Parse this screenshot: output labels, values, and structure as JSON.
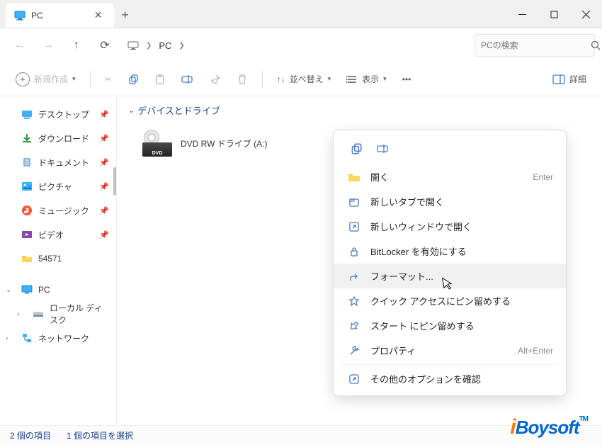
{
  "tab": {
    "title": "PC"
  },
  "address": {
    "location": "PC"
  },
  "search": {
    "placeholder": "PCの検索"
  },
  "toolbar": {
    "new": "新規作成",
    "sort": "並べ替え",
    "view": "表示",
    "details": "詳細"
  },
  "sidebar": {
    "items": [
      {
        "label": "デスクトップ"
      },
      {
        "label": "ダウンロード"
      },
      {
        "label": "ドキュメント"
      },
      {
        "label": "ピクチャ"
      },
      {
        "label": "ミュージック"
      },
      {
        "label": "ビデオ"
      },
      {
        "label": "54571"
      }
    ],
    "pc": "PC",
    "localdisk": "ローカル ディスク",
    "network": "ネットワーク"
  },
  "content": {
    "section": "デバイスとドライブ",
    "drive_label": "DVD RW ドライブ (A:)",
    "drive_badge": "DVD"
  },
  "context_menu": {
    "open": "開く",
    "open_shortcut": "Enter",
    "new_tab": "新しいタブで開く",
    "new_window": "新しいウィンドウで開く",
    "bitlocker": "BitLocker を有効にする",
    "format": "フォーマット...",
    "pin_quick": "クイック アクセスにピン留めする",
    "pin_start": "スタート にピン留めする",
    "properties": "プロパティ",
    "properties_shortcut": "Alt+Enter",
    "more_options": "その他のオプションを確認"
  },
  "statusbar": {
    "items": "2 個の項目",
    "selected": "1 個の項目を選択"
  },
  "watermark": {
    "i": "i",
    "text": "Boysoft",
    "tm": "TM"
  }
}
